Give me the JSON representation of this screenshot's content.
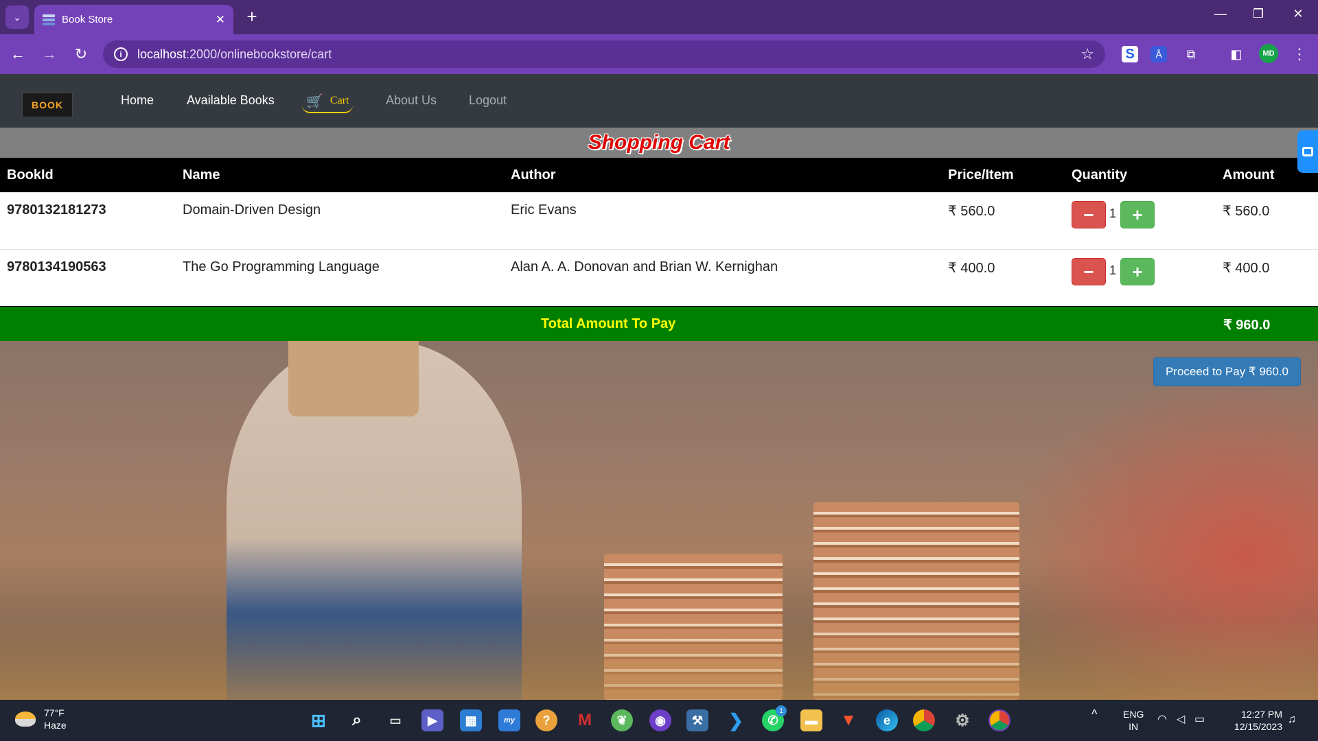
{
  "browser": {
    "tab_title": "Book Store",
    "url_host": "localhost",
    "url_path": ":2000/onlinebookstore/cart",
    "profile_initials": "MD"
  },
  "navbar": {
    "logo_text": "BOOK",
    "links": [
      {
        "label": "Home"
      },
      {
        "label": "Available Books"
      },
      {
        "label": "Cart"
      },
      {
        "label": "About Us"
      },
      {
        "label": "Logout"
      }
    ]
  },
  "cart": {
    "title": "Shopping Cart",
    "columns": [
      "BookId",
      "Name",
      "Author",
      "Price/Item",
      "Quantity",
      "Amount"
    ],
    "items": [
      {
        "book_id": "9780132181273",
        "name": "Domain-Driven Design",
        "author": "Eric Evans",
        "price": "₹ 560.0",
        "quantity": "1",
        "amount": "₹ 560.0"
      },
      {
        "book_id": "9780134190563",
        "name": "The Go Programming Language",
        "author": "Alan A. A. Donovan and Brian W. Kernighan",
        "price": "₹ 400.0",
        "quantity": "1",
        "amount": "₹ 400.0"
      }
    ],
    "total_label": "Total Amount To Pay",
    "total_amount": "₹ 960.0",
    "proceed_label": "Proceed to Pay ₹ 960.0"
  },
  "taskbar": {
    "temperature": "77°F",
    "weather": "Haze",
    "lang_line1": "ENG",
    "lang_line2": "IN",
    "time": "12:27 PM",
    "date": "12/15/2023",
    "whatsapp_badge": "1"
  },
  "colors": {
    "browser_frame": "#4a2b73",
    "browser_toolbar": "#7442b8",
    "navbar": "#343a40",
    "cart_accent": "#f5d000",
    "total_bar": "#008000",
    "minus_button": "#d9534f",
    "plus_button": "#5cb85c",
    "proceed_button": "#337ab7"
  }
}
